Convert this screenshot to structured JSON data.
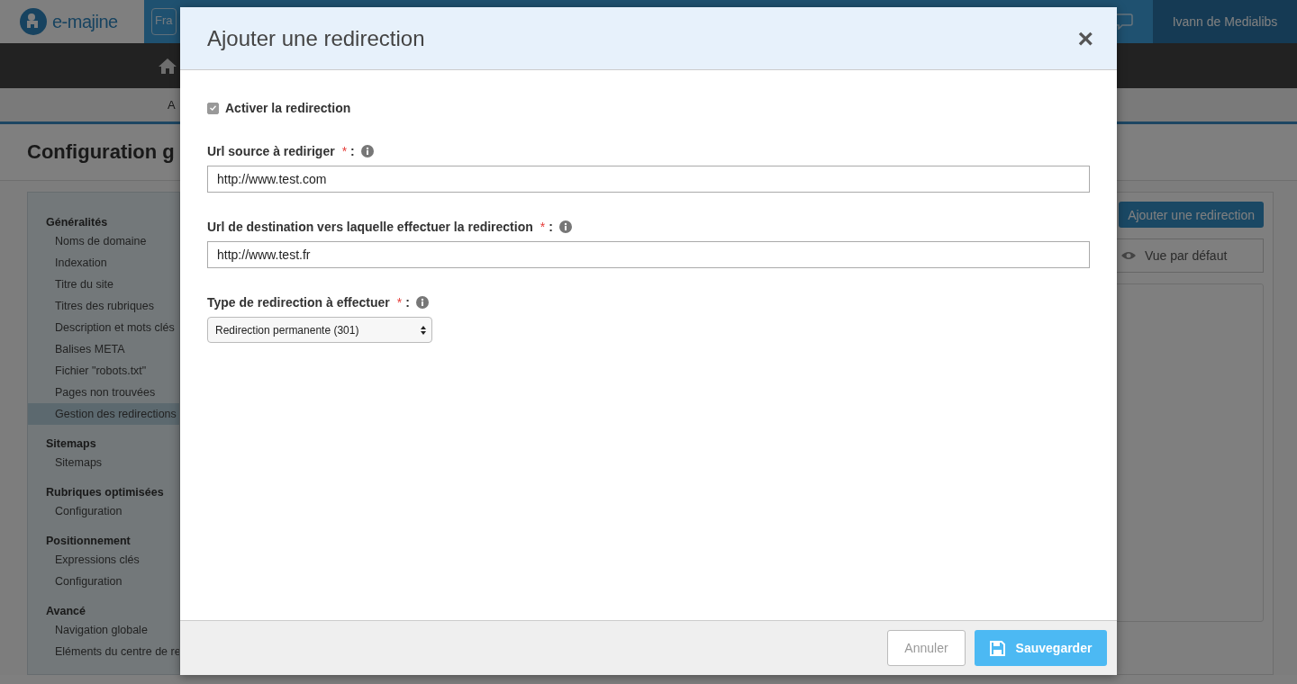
{
  "header": {
    "logo": "e-majine",
    "language": "Fra",
    "user": "Ivann de Medialibs"
  },
  "subnav": {
    "item": "A"
  },
  "page": {
    "title": "Configuration g"
  },
  "sidebar": {
    "sections": [
      {
        "title": "Généralités",
        "items": [
          {
            "label": "Noms de domaine",
            "selected": false
          },
          {
            "label": "Indexation",
            "selected": false
          },
          {
            "label": "Titre du site",
            "selected": false
          },
          {
            "label": "Titres des rubriques",
            "selected": false
          },
          {
            "label": "Description et mots clés",
            "selected": false
          },
          {
            "label": "Balises META",
            "selected": false
          },
          {
            "label": "Fichier \"robots.txt\"",
            "selected": false
          },
          {
            "label": "Pages non trouvées",
            "selected": false
          },
          {
            "label": "Gestion des redirections",
            "selected": true
          }
        ]
      },
      {
        "title": "Sitemaps",
        "items": [
          {
            "label": "Sitemaps",
            "selected": false
          }
        ]
      },
      {
        "title": "Rubriques optimisées",
        "items": [
          {
            "label": "Configuration",
            "selected": false
          }
        ]
      },
      {
        "title": "Positionnement",
        "items": [
          {
            "label": "Expressions clés",
            "selected": false
          },
          {
            "label": "Configuration",
            "selected": false
          }
        ]
      },
      {
        "title": "Avancé",
        "items": [
          {
            "label": "Navigation globale",
            "selected": false
          },
          {
            "label": "Eléments du centre de re",
            "selected": false
          }
        ]
      }
    ]
  },
  "toolbar": {
    "add_button": "Ajouter une redirection",
    "view_button": "Vue par défaut"
  },
  "dialog": {
    "title": "Ajouter une redirection",
    "close": "×",
    "enable": {
      "label": "Activer la redirection",
      "checked": true
    },
    "fields": [
      {
        "kind": "text",
        "label": "Url source à rediriger",
        "required_mark": "*",
        "colon": ":",
        "value": "http://www.test.com"
      },
      {
        "kind": "text",
        "label": "Url de destination vers laquelle effectuer la redirection",
        "required_mark": "*",
        "colon": ":",
        "value": "http://www.test.fr"
      },
      {
        "kind": "select",
        "label": "Type de redirection à effectuer",
        "required_mark": "*",
        "colon": ":",
        "value": "Redirection permanente (301)"
      }
    ],
    "buttons": [
      {
        "kind": "secondary",
        "label": "Annuler"
      },
      {
        "kind": "primary",
        "label": "Sauvegarder"
      }
    ]
  }
}
